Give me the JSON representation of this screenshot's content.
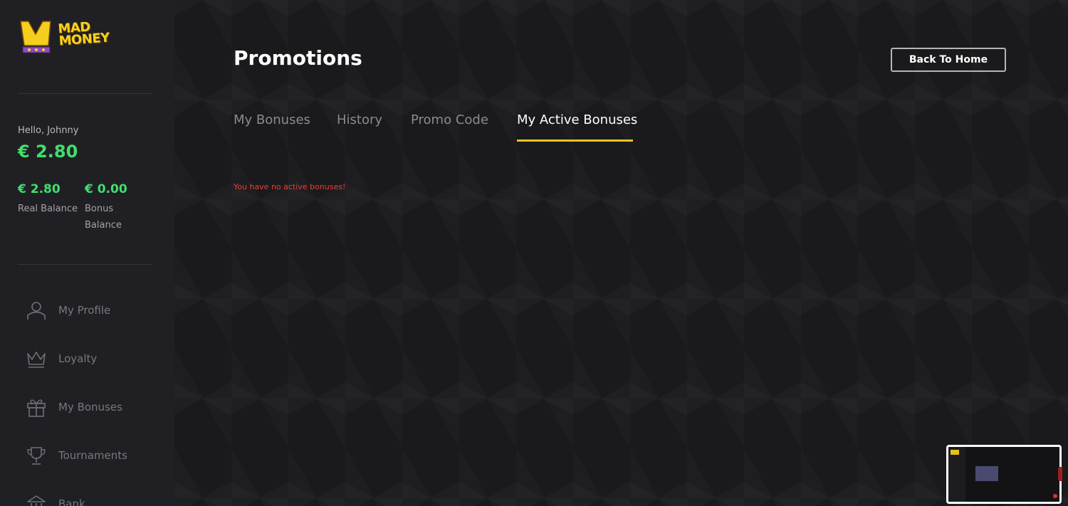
{
  "brand": {
    "logo_line1": "MAD",
    "logo_line2": "MONEY",
    "accent": "#f2c21b",
    "balance_color": "#3fe06c",
    "error_color": "#f23c2e"
  },
  "sidebar": {
    "greeting": "Hello, Johnny",
    "total_balance": "€ 2.80",
    "real_balance": {
      "amount": "€ 2.80",
      "label": "Real Balance"
    },
    "bonus_balance": {
      "amount": "€ 0.00",
      "label_line1": "Bonus",
      "label_line2": "Balance"
    },
    "nav": [
      {
        "label": "My Profile",
        "icon": "user-icon"
      },
      {
        "label": "Loyalty",
        "icon": "crown-icon"
      },
      {
        "label": "My Bonuses",
        "icon": "gift-icon"
      },
      {
        "label": "Tournaments",
        "icon": "trophy-icon"
      },
      {
        "label": "Bank",
        "icon": "bank-icon"
      }
    ]
  },
  "main": {
    "title": "Promotions",
    "back_button": "Back To Home",
    "tabs": [
      {
        "label": "My Bonuses",
        "active": false
      },
      {
        "label": "History",
        "active": false
      },
      {
        "label": "Promo Code",
        "active": false
      },
      {
        "label": "My Active Bonuses",
        "active": true
      }
    ],
    "empty_message": "You have no active bonuses!"
  }
}
